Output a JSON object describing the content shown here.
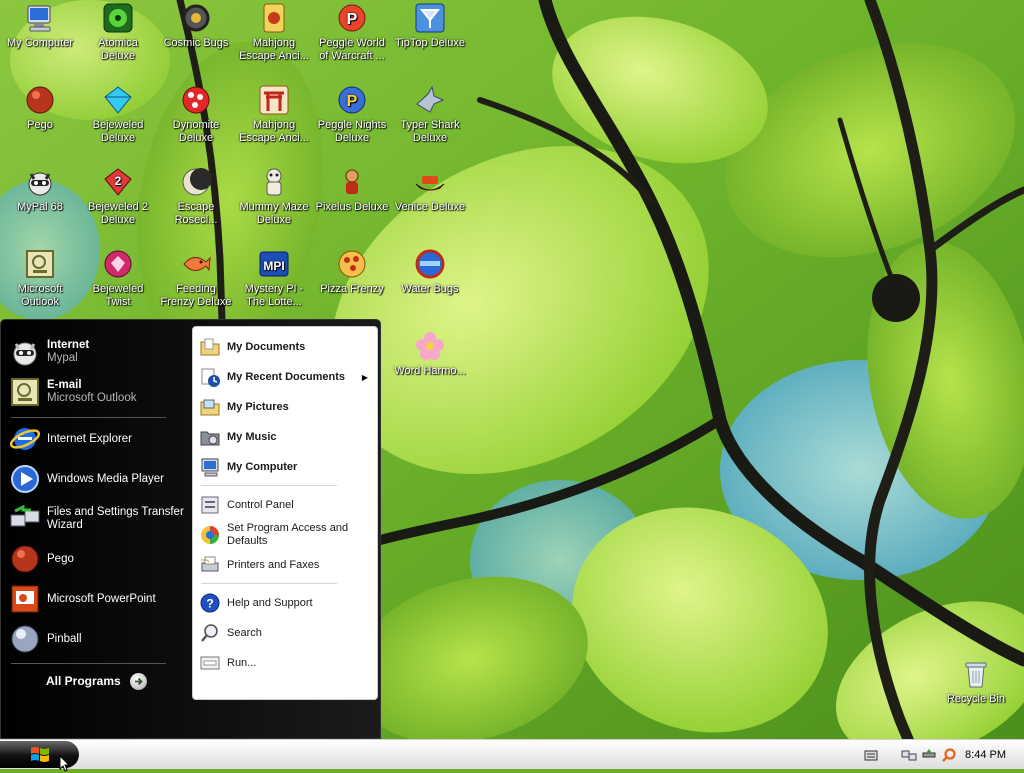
{
  "desktop": {
    "icons": [
      {
        "label": "My Computer"
      },
      {
        "label": "Atomica Deluxe"
      },
      {
        "label": "Cosmic Bugs"
      },
      {
        "label": "Mahjong Escape Anci..."
      },
      {
        "label": "Peggle World of Warcraft ..."
      },
      {
        "label": "TipTop Deluxe"
      },
      {
        "label": "Pego"
      },
      {
        "label": "Bejeweled Deluxe"
      },
      {
        "label": "Dynomite Deluxe"
      },
      {
        "label": "Mahjong Escape Anci..."
      },
      {
        "label": "Peggle Nights Deluxe"
      },
      {
        "label": "Typer Shark Deluxe"
      },
      {
        "label": "MyPal 68"
      },
      {
        "label": "Bejeweled 2 Deluxe"
      },
      {
        "label": "Escape Rosecl..."
      },
      {
        "label": "Mummy Maze Deluxe"
      },
      {
        "label": "Pixelus Deluxe"
      },
      {
        "label": "Venice Deluxe"
      },
      {
        "label": "Microsoft Outlook"
      },
      {
        "label": "Bejeweled Twist"
      },
      {
        "label": "Feeding Frenzy Deluxe"
      },
      {
        "label": "Mystery PI - The Lotte..."
      },
      {
        "label": "Pizza Frenzy"
      },
      {
        "label": "Water Bugs"
      },
      {
        "label": "Word Harmo..."
      },
      {
        "label": "Recycle Bin"
      }
    ]
  },
  "start_menu": {
    "pinned": [
      {
        "title": "Internet",
        "subtitle": "Mypal",
        "icon": "raccoon-icon"
      },
      {
        "title": "E-mail",
        "subtitle": "Microsoft Outlook",
        "icon": "outlook-icon"
      }
    ],
    "recent": [
      {
        "title": "Internet Explorer",
        "icon": "internet-explorer-icon"
      },
      {
        "title": "Windows Media Player",
        "icon": "media-player-icon"
      },
      {
        "title": "Files and Settings Transfer Wizard",
        "icon": "transfer-wizard-icon"
      },
      {
        "title": "Pego",
        "icon": "pego-icon"
      },
      {
        "title": "Microsoft PowerPoint",
        "icon": "powerpoint-icon"
      },
      {
        "title": "Pinball",
        "icon": "pinball-icon"
      }
    ],
    "all_programs_label": "All Programs",
    "places": [
      {
        "label": "My Documents"
      },
      {
        "label": "My Recent Documents"
      },
      {
        "label": "My Pictures"
      },
      {
        "label": "My Music"
      },
      {
        "label": "My Computer"
      }
    ],
    "settings": [
      {
        "label": "Control Panel"
      },
      {
        "label": "Set Program Access and Defaults"
      },
      {
        "label": "Printers and Faxes"
      }
    ],
    "help": [
      {
        "label": "Help and Support"
      },
      {
        "label": "Search"
      },
      {
        "label": "Run..."
      }
    ]
  },
  "taskbar": {
    "clock": "8:44 PM"
  }
}
